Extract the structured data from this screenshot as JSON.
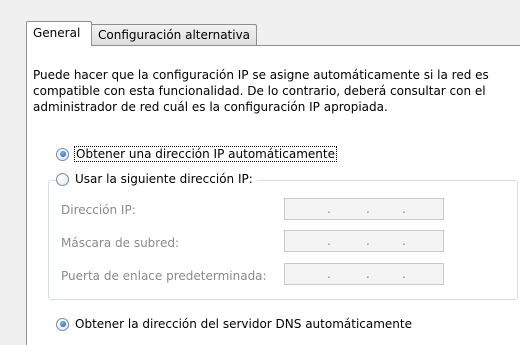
{
  "tabs": [
    {
      "label": "General",
      "active": true
    },
    {
      "label": "Configuración alternativa",
      "active": false
    }
  ],
  "description": "Puede hacer que la configuración IP se asigne automáticamente si la red es compatible con esta funcionalidad. De lo contrario, deberá consultar con el administrador de red cuál es la configuración IP apropiada.",
  "ip_options": {
    "auto": {
      "label": "Obtener una dirección IP automáticamente",
      "selected": true
    },
    "manual": {
      "label": "Usar la siguiente dirección IP:",
      "selected": false
    }
  },
  "fields": [
    {
      "label": "Dirección IP:",
      "value": "",
      "dots": [
        ".",
        ".",
        "."
      ]
    },
    {
      "label": "Máscara de subred:",
      "value": "",
      "dots": [
        ".",
        ".",
        "."
      ]
    },
    {
      "label": "Puerta de enlace predeterminada:",
      "value": "",
      "dots": [
        ".",
        ".",
        "."
      ]
    }
  ],
  "dns_options": {
    "auto": {
      "label": "Obtener la dirección del servidor DNS automáticamente",
      "selected": true
    }
  },
  "colors": {
    "selected_radio": "#1c5bb8",
    "disabled_text": "#8a8a8a",
    "panel_bg": "#ffffff",
    "dialog_bg": "#f0f0f0"
  }
}
